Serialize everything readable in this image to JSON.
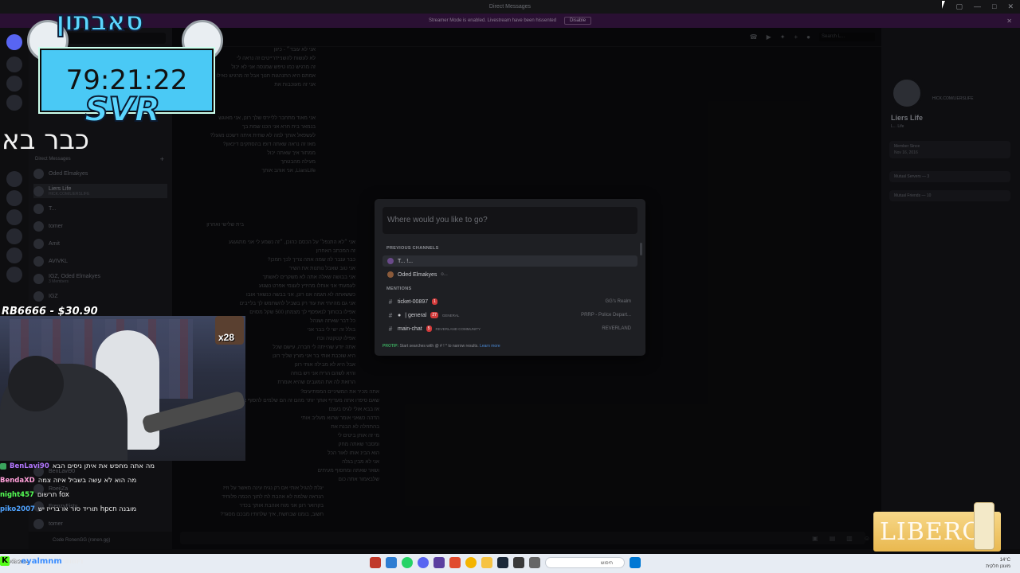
{
  "window": {
    "title": "Direct Messages"
  },
  "banner": {
    "text": "Streamer Mode is enabled. Livestream have been hissented",
    "button": "Disable"
  },
  "dm_sidebar": {
    "section": "Direct Messages",
    "items": [
      {
        "name": "Oded Elmakyes",
        "sub": ""
      },
      {
        "name": "Liers Life",
        "sub": "HICK.COM/LIERSLIFE"
      },
      {
        "name": "T...",
        "sub": ""
      },
      {
        "name": "tomer",
        "sub": ""
      },
      {
        "name": "Amit",
        "sub": ""
      },
      {
        "name": "AVIVKL",
        "sub": ""
      },
      {
        "name": "IGZ, Oded Elmakyes",
        "sub": "3 Members"
      },
      {
        "name": "IGZ",
        "sub": ""
      },
      {
        "name": "BenLavi90",
        "sub": ""
      },
      {
        "name": "RoeiiZa",
        "sub": ""
      },
      {
        "name": "FrenzyFisty",
        "sub": ""
      },
      {
        "name": "tomer",
        "sub": ""
      }
    ],
    "user_panel": "Code RonenGG (ronen.gg)"
  },
  "chat": {
    "messages_top": [
      "אני לא עובד״ - כיוון",
      "לא לעשות להשניידרייטים זה נראה לי",
      "זה מרגיש כמו טיפש שמנסה אני לא יכול",
      "אמתם היא התנהגות חנוך אבל זה מרגיש כאילו",
      "אני זה מעוכבות את"
    ],
    "messages_mid": [
      "אני מאוד מתחבר לליירס שלך רונן, אני מאוגש",
      "בנמאר בית חרא אני הכנו שמת בך",
      "לעשפאל אותך למה לא שחית איתה דשכט מגעל?",
      "מאז זה נראה שאתה דופו בהסתקים דיכאון?",
      "ממתור איך שאתה יכול",
      "מעילה מהבטחך",
      "LiarsLife, אני אוהב אותך"
    ],
    "messages_low_header": "בית שלישי ואחרון",
    "messages_low": [
      "אני ״לא התנפל׳ על הכסם כהוכן, ״זה נשמע לי אני מתגעגע",
      "זה המכתב האחרון",
      "כבר ענבר לה שמה אתה צריך לכך חמכן?",
      "אני טוב שאבל נותנות את השיר",
      "אני בבושה שאלה אתה לא משקרים לאשתך",
      "לעמעתי אני אוחלו מהיזיץ לעצמי אפרט נשגוע",
      "כששאתה לא תגמה אנו רונן, אני בבשה כנשאר אובו",
      "אני גם מהיותי את עוד רק בשביל להשתמש לך בלייבים",
      "אפילו בכוחוך לנאפסף לך מצמחן 500 שקל מסוים",
      "כל דבר שאתה ושנהל",
      "בולל זה ישי לי בבר אני",
      "אפילו קטקטה וכח",
      "אתה יודע שהייתה לי חברה, עישם שכל",
      "היא שוכבת אותי בר אני מורץ שליך רונן",
      "אבל היא לא מבילה אותי רונן",
      "והיא לשהם הריח אני ויש בוחה",
      "הרואת לה את המעבים שהיא אומרת"
    ],
    "messages_bottom": [
      "אתה מכיר את המשיניים המפתיעים?",
      "שאם סיפרו אתה מעדיף אותך יותר מהם זה הם שלמים להסוף אתה",
      "אז בבא אולי לגיס בעצם",
      "הדהה כשאני אומר שהוא מעליב אותי",
      "בהתחלה לא הבנת את",
      "מי זה אותן ביטים לי",
      "ומסבר שאתה מחק",
      "הוא הבינ אותו לאור הכל",
      "אני לא מבין בגלה",
      "ושאר שאתה ומחסוף מעיתים",
      "שלבאמור אתה כום"
    ],
    "messages_end": [
      "יגלת להגיל אותי אם רק נגיח עינה מאשר על וזיז",
      "הנראה שלמת לא אהבת לת לתוך הכמה פלוחיד",
      "בקרואר רונן אני מוח אוהבת אותך בכדר",
      "חשוב, בומנו שבחשת, איך שלחתיו מבכם מסגד?"
    ],
    "header_search": "Search L..."
  },
  "profile": {
    "handle": "HICK.COM/LIERSLIFE",
    "name": "Liers Life",
    "tag": "L...  Life",
    "member_since_label": "Member Since",
    "member_since": "Nov 16, 2016",
    "mutual_servers": "Mutual Servers — 3",
    "mutual_friends": "Mutual Friends — 10"
  },
  "switcher": {
    "placeholder": "Where would you like to go?",
    "previous_label": "PREVIOUS CHANNELS",
    "previous": [
      {
        "name": "T... !...",
        "selected": true
      },
      {
        "name": "Oded Elmakyes",
        "suffix": "o...",
        "selected": false
      }
    ],
    "mentions_label": "MENTIONS",
    "mentions": [
      {
        "name": "ticket-00897",
        "badge": "1",
        "category": "",
        "server": "GG's Realm"
      },
      {
        "name": "| general",
        "badge": "27",
        "category": "GENERAL",
        "server": "PRRP - Police Depart..."
      },
      {
        "name": "main-chat",
        "badge": "5",
        "category": "REVERLAND COMMUNITY",
        "server": "REVERLAND"
      }
    ],
    "tip_prefix": "PROTIP:",
    "tip_text": "Start searches with @ # ! * to narrow results.",
    "tip_link": "Learn more"
  },
  "overlay": {
    "timer_heading": "סאבתון",
    "timer": "79:21:22",
    "timer_label": "SVR",
    "already_comes": "כבר בא",
    "donation": "RB6666 - $30.90",
    "cam_badge": "x28"
  },
  "twitch_chat": [
    {
      "user": "BenLavi90",
      "color": "#b377ff",
      "msg": "מה אתה מחפש את איתן ניסים הבא"
    },
    {
      "user": "BendaXD",
      "color": "#ff9fd8",
      "msg": "מה הוא לא עשה בשביל איזה צמה"
    },
    {
      "user": "night457",
      "color": "#55ff55",
      "msg": "fox תרשום"
    },
    {
      "user": "piko2007",
      "color": "#4fa3ff",
      "msg": "מובנה hpcn תוריד סור או ברייז יש"
    }
  ],
  "stream_bar": {
    "user": "eyalmnm",
    "sub": "דיוווווווו"
  },
  "logo": {
    "text": "LIBERO"
  },
  "taskbar": {
    "search": "חיפוש",
    "weather": "14°C",
    "date": "14/08/2024",
    "location": "מעונן חלקית"
  }
}
